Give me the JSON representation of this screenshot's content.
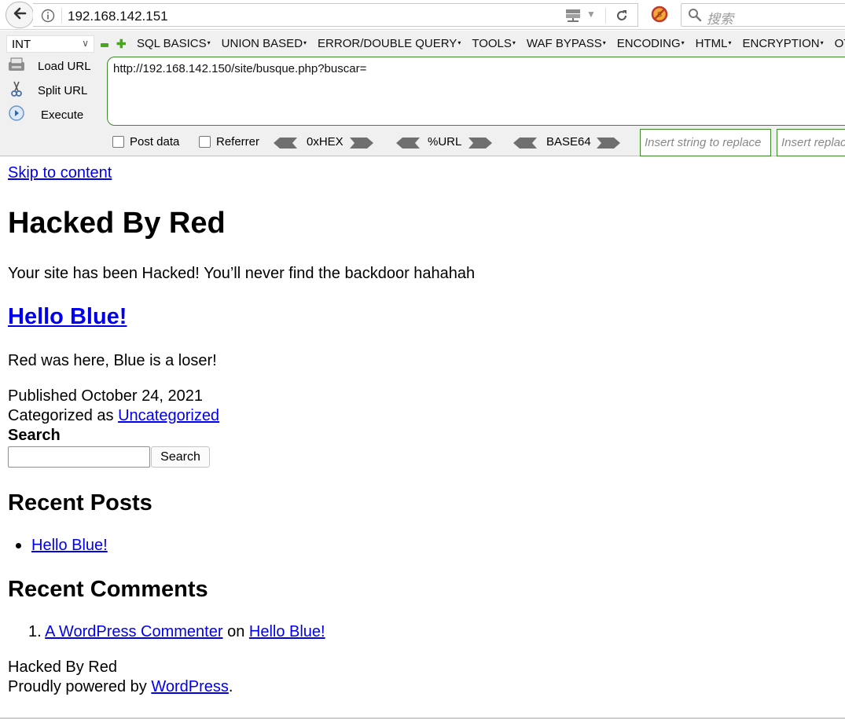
{
  "browser": {
    "url": "192.168.142.151",
    "search_placeholder": "搜索"
  },
  "hackbar": {
    "type_select": "INT",
    "menu": [
      "SQL BASICS",
      "UNION BASED",
      "ERROR/DOUBLE QUERY",
      "TOOLS",
      "WAF BYPASS",
      "ENCODING",
      "HTML",
      "ENCRYPTION",
      "OT"
    ],
    "load_url": "Load URL",
    "split_url": "Split URL",
    "execute": "Execute",
    "target_url": "http://192.168.142.150/site/busque.php?buscar=",
    "post_data": "Post data",
    "referrer": "Referrer",
    "hex": "0xHEX",
    "url_enc": "%URL",
    "base64": "BASE64",
    "replace_placeholder": "Insert string to replace",
    "replacement_placeholder": "Insert replacing string"
  },
  "page": {
    "skip_link": "Skip to content",
    "site_title": "Hacked By Red",
    "tagline": "Your site has been Hacked! You’ll never find the backdoor hahahah",
    "post_title": "Hello Blue!",
    "post_body": "Red was here, Blue is a loser!",
    "published_prefix": "Published",
    "published_date": "October 24, 2021",
    "categorized_prefix": "Categorized as",
    "category": "Uncategorized",
    "search_label": "Search",
    "search_button": "Search",
    "recent_posts_heading": "Recent Posts",
    "recent_posts": [
      "Hello Blue!"
    ],
    "recent_comments_heading": "Recent Comments",
    "comment_number": "1.",
    "comment_author": "A WordPress Commenter",
    "comment_on": "on",
    "comment_post": "Hello Blue!",
    "footer_site": "Hacked By Red",
    "footer_powered_prefix": "Proudly powered by",
    "footer_powered_link": "WordPress",
    "footer_period": "."
  },
  "colors": {
    "link": "#0000ee",
    "hackbar_green": "#3c8a2a",
    "hackbar_bg": "#f0f0f0"
  }
}
